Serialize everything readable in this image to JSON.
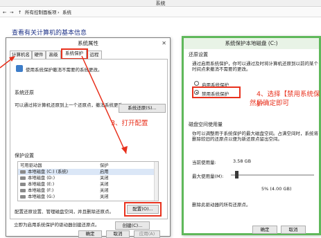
{
  "window": {
    "title": "系统"
  },
  "breadcrumb": [
    "所有控制面板项",
    "系统"
  ],
  "background": {
    "heading": "查看有关计算机的基本信息"
  },
  "sysprops": {
    "title": "系统属性",
    "tabs": [
      "计算机名",
      "硬件",
      "高级",
      "系统保护",
      "远程"
    ],
    "intro": "使用系统保护撤消不需要的系统更改。",
    "restore_group": "系统还原",
    "restore_text": "可以通过将计算机还原到上一个还原点，撤消系统更改。",
    "restore_button": "系统还原(S)...",
    "protect_group": "保护设置",
    "col_drive": "可用驱动器",
    "col_protection": "保护",
    "drives": [
      {
        "name": "本地磁盘 (C:) (系统)",
        "status": "启用"
      },
      {
        "name": "本地磁盘 (D:)",
        "status": "关闭"
      },
      {
        "name": "本地磁盘 (E:)",
        "status": "关闭"
      },
      {
        "name": "本地磁盘 (F:)",
        "status": "关闭"
      },
      {
        "name": "本地磁盘 (G:)",
        "status": "关闭"
      }
    ],
    "configure_text": "配置还原设置、管理磁盘空间，并且删除还原点。",
    "configure_button": "配置(O)...",
    "create_text": "立即为启用系统保护的驱动器创建还原点。",
    "create_button": "创建(C)...",
    "ok": "确定",
    "cancel": "取消",
    "apply": "应用(A)"
  },
  "protect_dialog": {
    "title": "系统保护本地磁盘 (C:)",
    "restore_settings": "还原设置",
    "restore_desc": "通过启用系统保护，你可以通过及时将计算机还原到以前的某个时间点来撤消不需要的更改。",
    "option_enable": "启用系统保护",
    "option_disable": "禁用系统保护",
    "disk_usage": "磁盘空间使用量",
    "usage_desc": "你可以调整用于系统保护的最大磁盘空间。占满空间时，系统将删除较旧的还原点以便为新还原点留出空间。",
    "current_label": "当前使用量:",
    "current_value": "3.58 GB",
    "max_label": "最大使用量(M):",
    "max_value": "5% (4.00 GB)",
    "slider_percent": 5,
    "delete_text": "删除此驱动器的所有还原点。",
    "ok": "确定",
    "cancel": "取消"
  },
  "annotations": {
    "step3": "3、打开配置",
    "step4_line1": "4、选择【禁用系统保护",
    "step4_line2": "然后确定即可"
  },
  "colors": {
    "annotation": "#e8301c",
    "dialog_bg": "#ffffff",
    "link_blue": "#1e3287"
  }
}
